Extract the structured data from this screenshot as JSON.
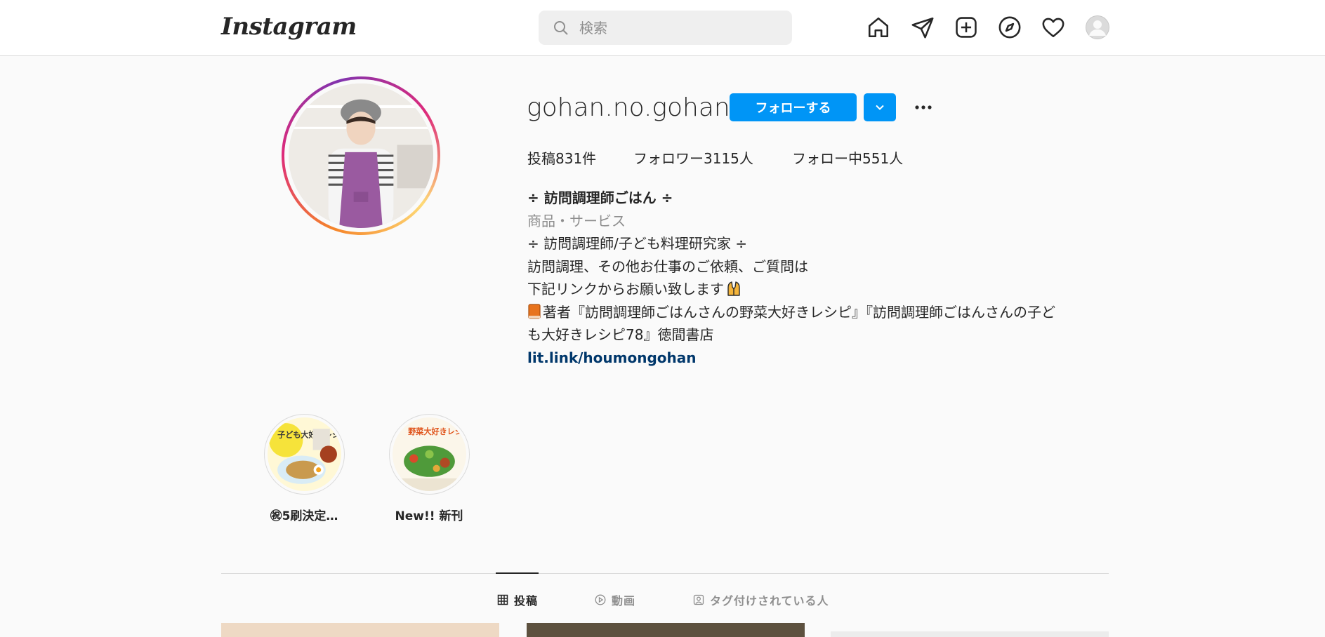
{
  "nav": {
    "logo": "Instagram",
    "search_placeholder": "検索",
    "icons": [
      "home-icon",
      "direct-message-icon",
      "new-post-icon",
      "explore-icon",
      "activity-heart-icon",
      "profile-avatar"
    ]
  },
  "profile": {
    "username": "gohan.no.gohan",
    "follow_label": "フォローする",
    "stats": {
      "posts": "投稿831件",
      "followers": "フォロワー3115人",
      "following": "フォロー中551人"
    },
    "bio": {
      "name": "÷ 訪問調理師ごはん ÷",
      "category": "商品・サービス",
      "line1": "÷ 訪問調理師/子ども料理研究家 ÷",
      "line2": "訪問調理、その他お仕事のご依頼、ご質問は",
      "line3": "下記リンクからお願い致します",
      "line4a": "著者『訪問調理師ごはんさんの野菜大好きレシピ』『訪問調理師ごはんさんの子ど",
      "line4b": "も大好きレシピ78』徳間書店",
      "link": "lit.link/houmongohan"
    }
  },
  "highlights": [
    {
      "label": "㊗5刷決定…",
      "cover_text": "子ども大好きレシピ"
    },
    {
      "label": "New!! 新刊",
      "cover_text": "野菜大好きレシピ"
    }
  ],
  "tabs": [
    {
      "label": "投稿",
      "active": true
    },
    {
      "label": "動画",
      "active": false
    },
    {
      "label": "タグ付けされている人",
      "active": false
    }
  ],
  "colors": {
    "accent": "#0095f6",
    "link": "#00376b",
    "muted": "#8e8e8e",
    "border": "#dbdbdb"
  }
}
